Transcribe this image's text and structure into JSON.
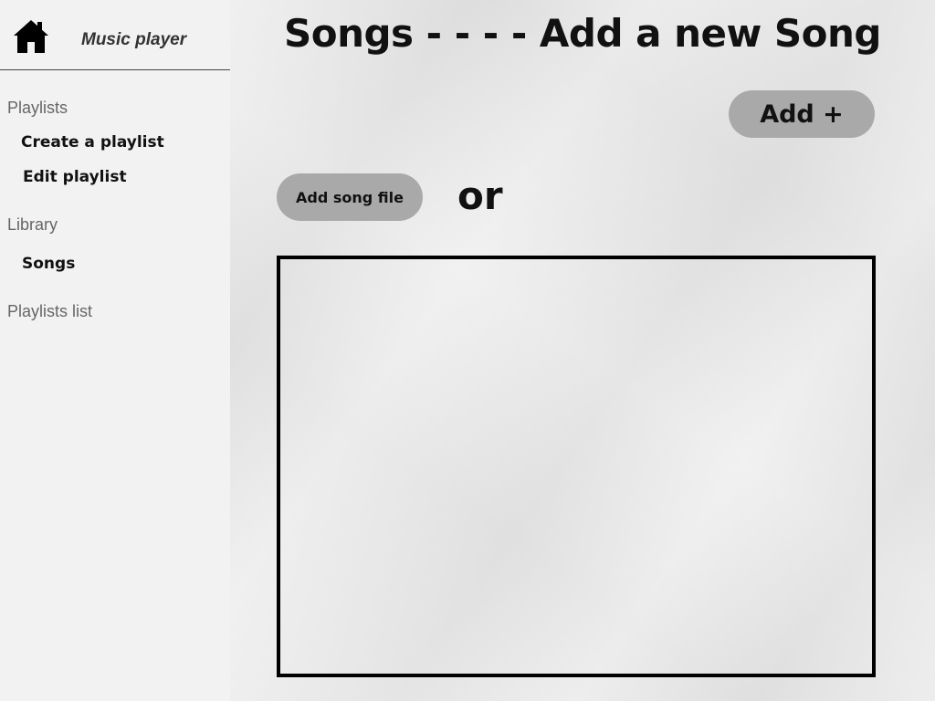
{
  "app": {
    "title": "Music player"
  },
  "sidebar": {
    "home_icon": "home-icon",
    "sections": {
      "playlists": {
        "label": "Playlists",
        "items": [
          {
            "label": "Create a playlist"
          },
          {
            "label": "Edit playlist"
          }
        ]
      },
      "library": {
        "label": "Library",
        "items": [
          {
            "label": "Songs"
          }
        ]
      },
      "playlists_list": {
        "label": "Playlists list"
      }
    }
  },
  "main": {
    "title": "Songs - - - - Add a new Song",
    "add_button_label": "Add +",
    "add_song_file_label": "Add song file",
    "or_label": "or"
  },
  "colors": {
    "sidebar_bg": "#f2f2f2",
    "button_bg": "#a9a9a9",
    "text": "#111111",
    "section_label": "#666666"
  }
}
